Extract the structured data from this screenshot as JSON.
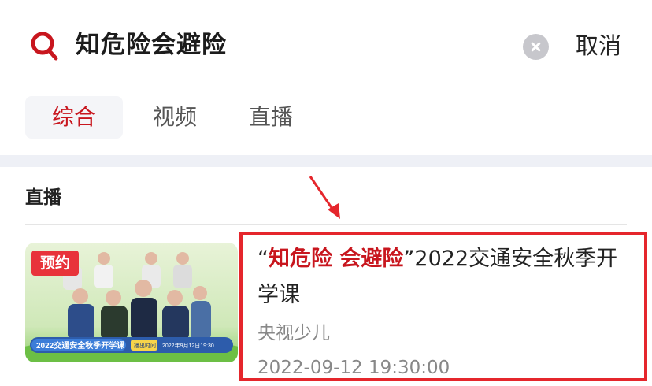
{
  "search": {
    "query": "知危险会避险",
    "cancel_label": "取消",
    "icon": "search-icon"
  },
  "tabs": [
    {
      "label": "综合",
      "active": true
    },
    {
      "label": "视频",
      "active": false
    },
    {
      "label": "直播",
      "active": false
    }
  ],
  "section": {
    "title": "直播"
  },
  "result": {
    "badge": "预约",
    "title_quote_open": "“",
    "title_highlight": "知危险 会避险",
    "title_quote_close": "”",
    "title_rest": "2022交通安全秋季开学课",
    "channel": "央视少儿",
    "datetime": "2022-09-12 19:30:00",
    "thumbnail_caption": "2022交通安全秋季开学课",
    "thumbnail_time_label": "播出时间",
    "thumbnail_time": "2022年9月12日19:30"
  },
  "colors": {
    "accent": "#c8161e",
    "annotation": "#e5262c",
    "badge": "#e8333a"
  }
}
